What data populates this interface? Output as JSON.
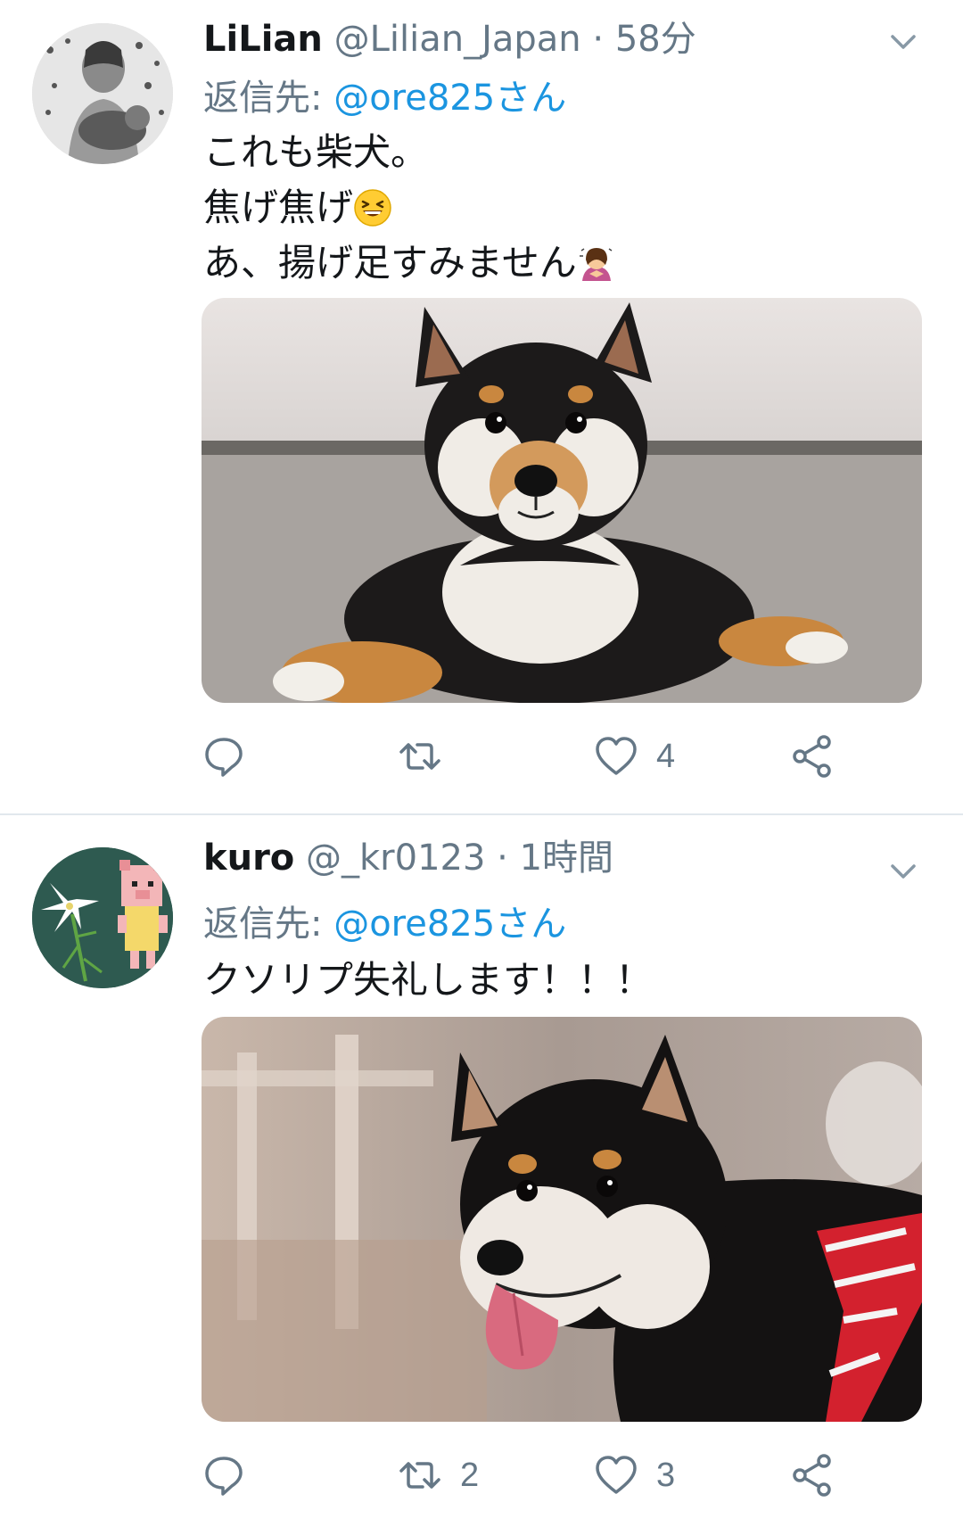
{
  "tweets": [
    {
      "display_name": "LiLian",
      "handle": "@Lilian_Japan",
      "separator": "·",
      "time": "58分",
      "reply_prefix": "返信先:",
      "reply_target": "@ore825さん",
      "text_lines": [
        "これも柴犬。",
        "焦げ焦げ",
        "あ、揚げ足すみません"
      ],
      "emojis": [
        "grinning-squinting-face",
        "woman-bowing"
      ],
      "image": "black-and-tan-shiba-puppy-lying-on-floor",
      "actions": {
        "reply_count": "",
        "retweet_count": "",
        "like_count": "4"
      }
    },
    {
      "display_name": "kuro",
      "handle": "@_kr0123",
      "separator": "·",
      "time": "1時間",
      "reply_prefix": "返信先:",
      "reply_target": "@ore825さん",
      "text_lines": [
        "クソリプ失礼します！！！"
      ],
      "image": "black-and-tan-shiba-with-red-harness",
      "actions": {
        "reply_count": "",
        "retweet_count": "2",
        "like_count": "3"
      }
    }
  ],
  "colors": {
    "text_primary": "#14171a",
    "text_secondary": "#657786",
    "link": "#1b95e0",
    "divider": "#e1e8ed"
  }
}
